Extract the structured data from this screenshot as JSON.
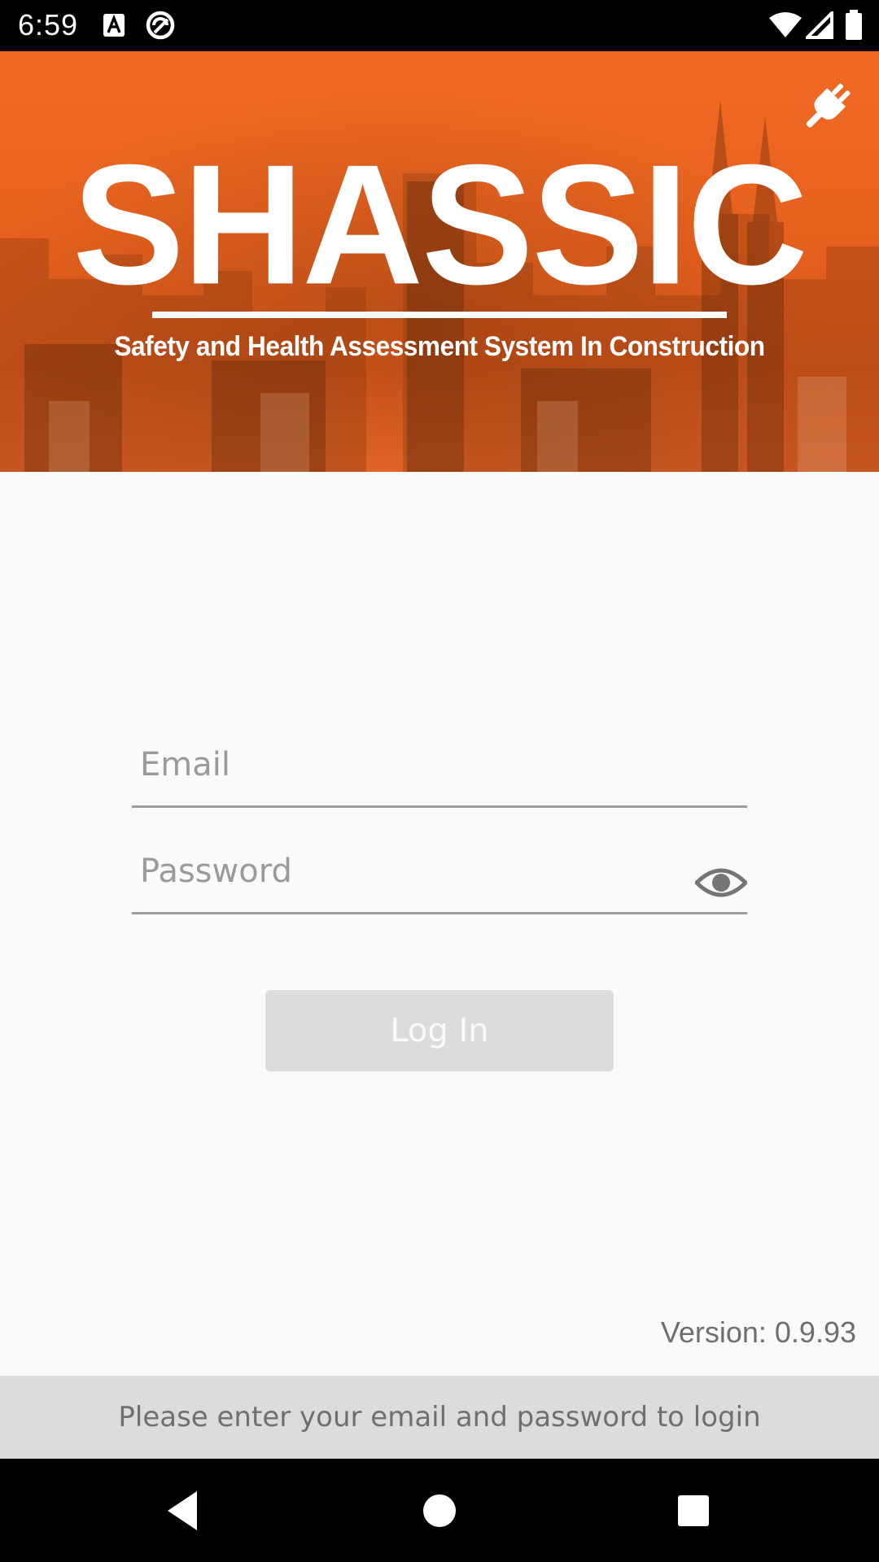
{
  "status_bar": {
    "time": "6:59",
    "icons": [
      "text-a-icon",
      "no-disturb-icon",
      "wifi-icon",
      "signal-icon",
      "battery-icon"
    ]
  },
  "header": {
    "title": "SHASSIC",
    "subtitle": "Safety and Health Assessment System In Construction",
    "plug_icon": "plug-icon",
    "accent_color": "#e8621f"
  },
  "form": {
    "email_placeholder": "Email",
    "email_value": "",
    "password_placeholder": "Password",
    "password_value": "",
    "eye_icon": "eye-icon",
    "login_label": "Log In"
  },
  "footer": {
    "version": "Version: 0.9.93",
    "hint": "Please enter your email and password to login"
  },
  "nav": {
    "icons": [
      "back-icon",
      "home-icon",
      "recents-icon"
    ]
  }
}
